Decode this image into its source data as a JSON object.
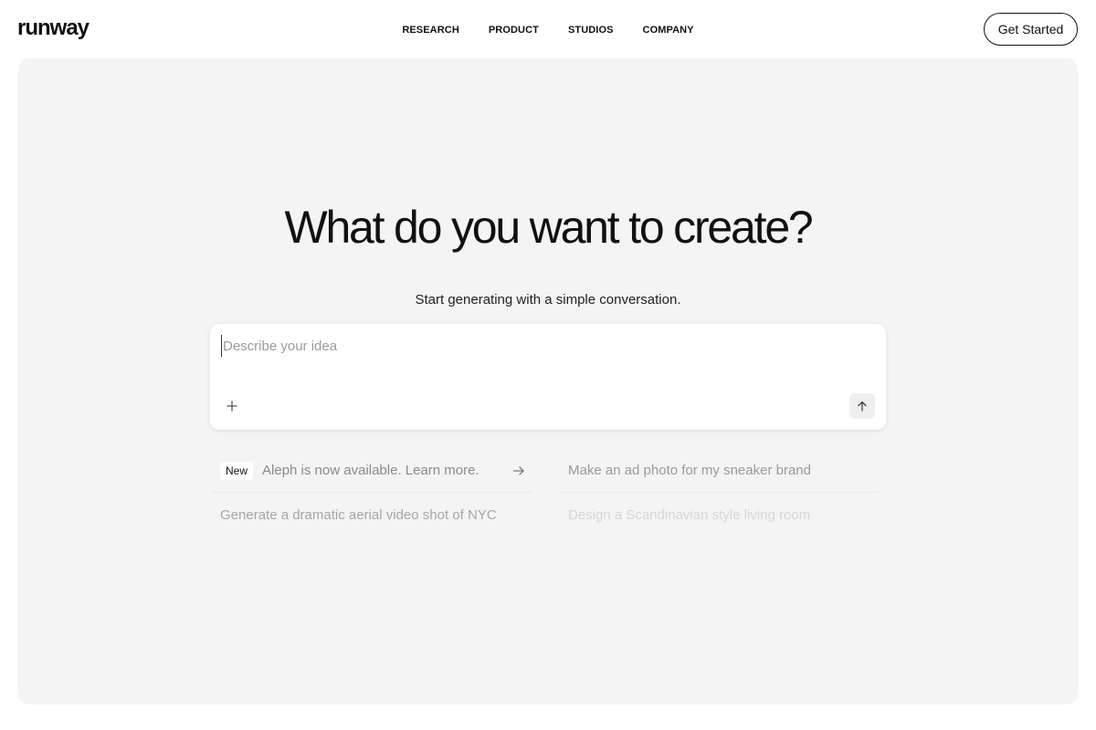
{
  "header": {
    "logo": "runway",
    "nav": [
      "RESEARCH",
      "PRODUCT",
      "STUDIOS",
      "COMPANY"
    ],
    "cta_label": "Get Started"
  },
  "hero": {
    "title": "What do you want to create?",
    "subtitle": "Start generating with a simple conversation."
  },
  "prompt": {
    "placeholder": "Describe your idea",
    "add_icon": "plus-icon",
    "send_icon": "arrow-up-icon"
  },
  "suggestions": [
    {
      "badge": "New",
      "text": "Aleph is now available. Learn more.",
      "icon": "arrow-right-icon"
    },
    {
      "text": "Make an ad photo for my sneaker brand"
    },
    {
      "text": "Generate a dramatic aerial video shot of NYC"
    },
    {
      "text": "Design a Scandinavian style living room"
    }
  ],
  "colors": {
    "background": "#ffffff",
    "panel": "#f4f4f4",
    "text": "#111111",
    "muted": "#9a9a9a"
  }
}
